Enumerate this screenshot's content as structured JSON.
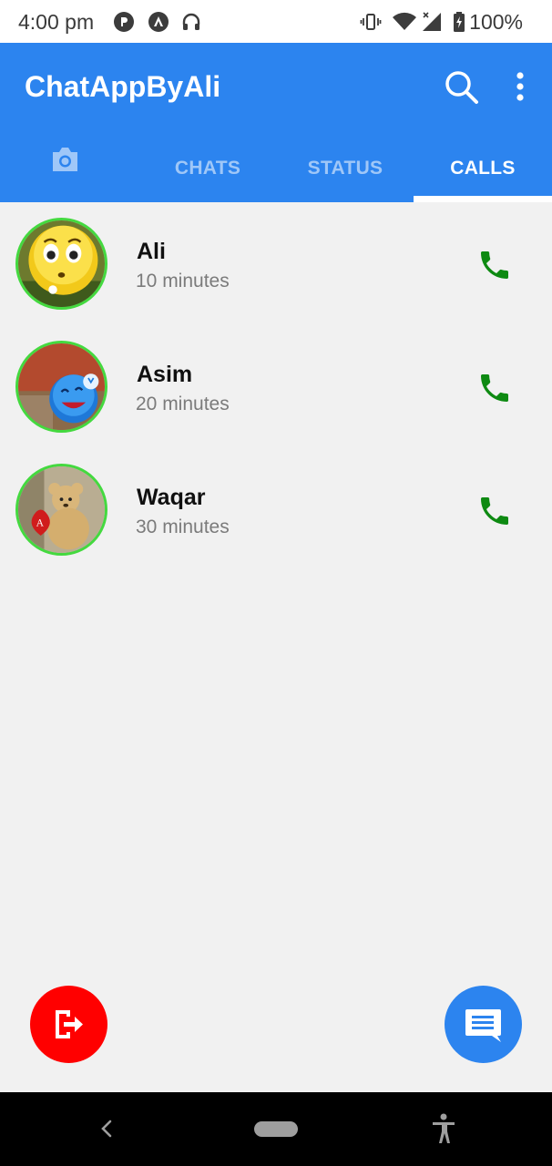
{
  "status_bar": {
    "time": "4:00 pm",
    "battery": "100%",
    "icons": [
      "pocket-casts-icon",
      "arrow-app-icon",
      "headphones-icon",
      "vibrate-icon",
      "wifi-icon",
      "signal-icon",
      "battery-icon"
    ]
  },
  "app_bar": {
    "title": "ChatAppByAli",
    "color": "#2c84ef",
    "actions": [
      "search-icon",
      "more-vert-icon"
    ]
  },
  "tabs": [
    {
      "id": "camera",
      "icon": "camera-icon",
      "label": ""
    },
    {
      "id": "chats",
      "label": "CHATS"
    },
    {
      "id": "status",
      "label": "STATUS"
    },
    {
      "id": "calls",
      "label": "CALLS",
      "selected": true
    }
  ],
  "calls": [
    {
      "name": "Ali",
      "duration": "10 minutes",
      "avatar": "yellow-emoji-ball",
      "action_icon": "phone-icon"
    },
    {
      "name": "Asim",
      "duration": "20 minutes",
      "avatar": "blue-emoji-ball",
      "action_icon": "phone-icon"
    },
    {
      "name": "Waqar",
      "duration": "30 minutes",
      "avatar": "teddy-bear",
      "action_icon": "phone-icon"
    }
  ],
  "fabs": {
    "logout": {
      "icon": "logout-icon",
      "color": "#ff0000"
    },
    "new_chat": {
      "icon": "chat-icon",
      "color": "#2c84ef"
    }
  },
  "colors": {
    "accent": "#2c84ef",
    "avatar_ring": "#44d93f",
    "call_icon": "#0e8a12",
    "background": "#f1f1f1"
  },
  "nav_bar": {
    "icons": [
      "back-icon",
      "home-pill",
      "accessibility-icon"
    ]
  }
}
